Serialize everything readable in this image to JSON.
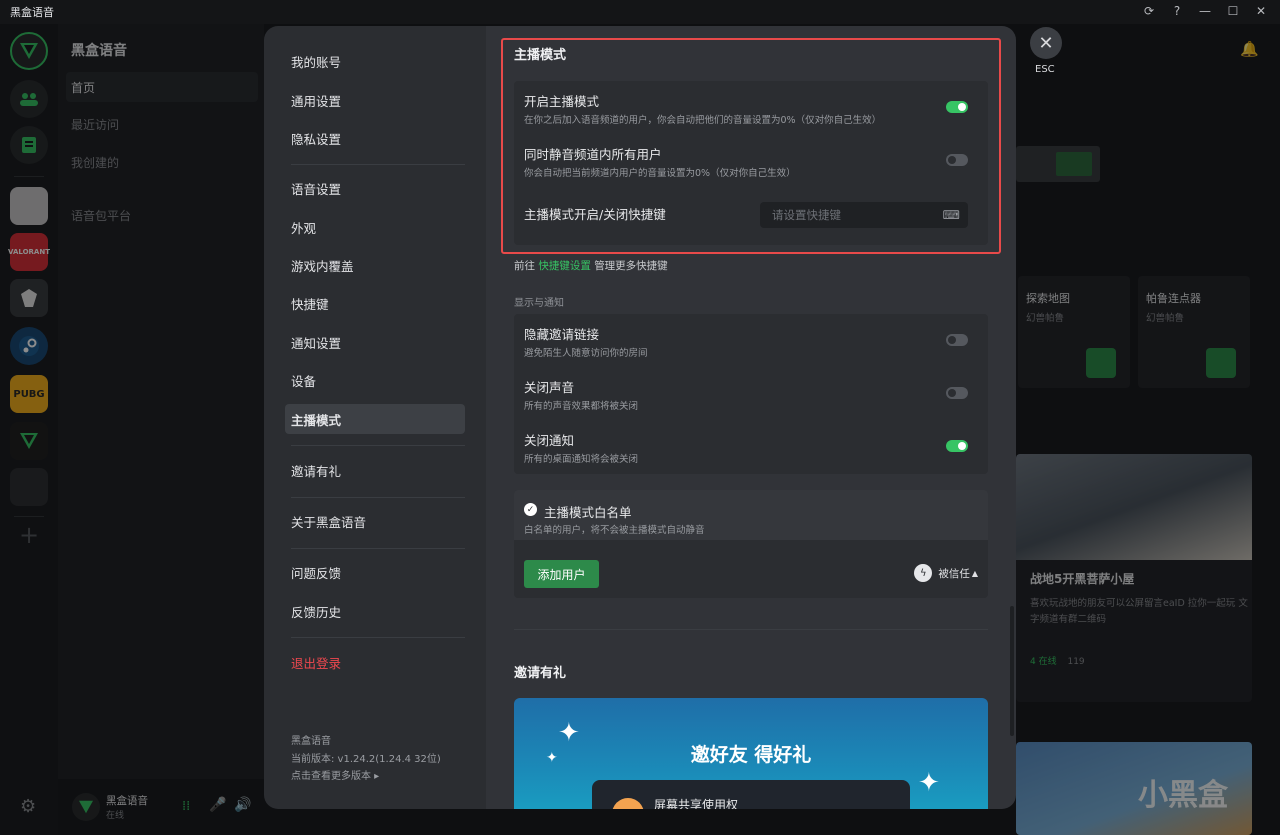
{
  "titlebar": {
    "title": "黑盒语音"
  },
  "sidebar": {
    "brand": "黑盒语音",
    "items": [
      {
        "label": "首页",
        "active": true
      },
      {
        "label": "最近访问"
      },
      {
        "label": "我创建的"
      },
      {
        "label": "语音包平台"
      }
    ],
    "user": {
      "name": "黑盒语音",
      "status": "在线"
    }
  },
  "rail": {
    "games": [
      "PUBG"
    ]
  },
  "background": {
    "cards": [
      {
        "title": "探索地图",
        "sub": "幻兽帕鲁"
      },
      {
        "title": "帕鲁连点器",
        "sub": "幻兽帕鲁"
      }
    ],
    "room": {
      "title": "战地5开黑菩萨小屋",
      "desc": "喜欢玩战地的朋友可以公屏留言eaID 拉你一起玩 文字频道有群二维码",
      "online": "4 在线",
      "members": "119"
    },
    "watermark": "小黑盒"
  },
  "modal": {
    "nav": [
      {
        "label": "我的账号"
      },
      {
        "label": "通用设置"
      },
      {
        "label": "隐私设置"
      },
      {
        "label": "语音设置"
      },
      {
        "label": "外观"
      },
      {
        "label": "游戏内覆盖"
      },
      {
        "label": "快捷键"
      },
      {
        "label": "通知设置"
      },
      {
        "label": "设备"
      },
      {
        "label": "主播模式"
      },
      {
        "label": "邀请有礼"
      },
      {
        "label": "关于黑盒语音"
      },
      {
        "label": "问题反馈"
      },
      {
        "label": "反馈历史"
      },
      {
        "label": "退出登录"
      }
    ],
    "version": {
      "app": "黑盒语音",
      "current": "当前版本: v1.24.2(1.24.4 32位)",
      "more": "点击查看更多版本 ▸"
    },
    "esc": "ESC",
    "streamer": {
      "title": "主播模式",
      "enable": {
        "label": "开启主播模式",
        "desc": "在你之后加入语音频道的用户，你会自动把他们的音量设置为0%（仅对你自己生效）",
        "on": true
      },
      "mute_all": {
        "label": "同时静音频道内所有用户",
        "desc": "你会自动把当前频道内用户的音量设置为0%（仅对你自己生效）",
        "on": false
      },
      "hotkey": {
        "label": "主播模式开启/关闭快捷键",
        "placeholder": "请设置快捷键"
      },
      "hint_pre": "前往",
      "hint_link": "快捷键设置",
      "hint_post": "管理更多快捷键",
      "group_title": "显示与通知",
      "hide_invite": {
        "label": "隐藏邀请链接",
        "desc": "避免陌生人随意访问你的房间",
        "on": false
      },
      "mute_sound": {
        "label": "关闭声音",
        "desc": "所有的声音效果都将被关闭",
        "on": false
      },
      "mute_notify": {
        "label": "关闭通知",
        "desc": "所有的桌面通知将会被关闭",
        "on": true
      },
      "whitelist": {
        "title": "主播模式白名单",
        "desc": "白名单的用户，将不会被主播模式自动静音",
        "add": "添加用户",
        "trusted": "被信任"
      }
    },
    "invite": {
      "title": "邀请有礼",
      "banner": "邀好友 得好礼",
      "sub": "屏幕共享使用权"
    }
  },
  "colors": {
    "accent": "#37c464",
    "danger": "#f0484f",
    "highlight": "#e84a4a"
  }
}
